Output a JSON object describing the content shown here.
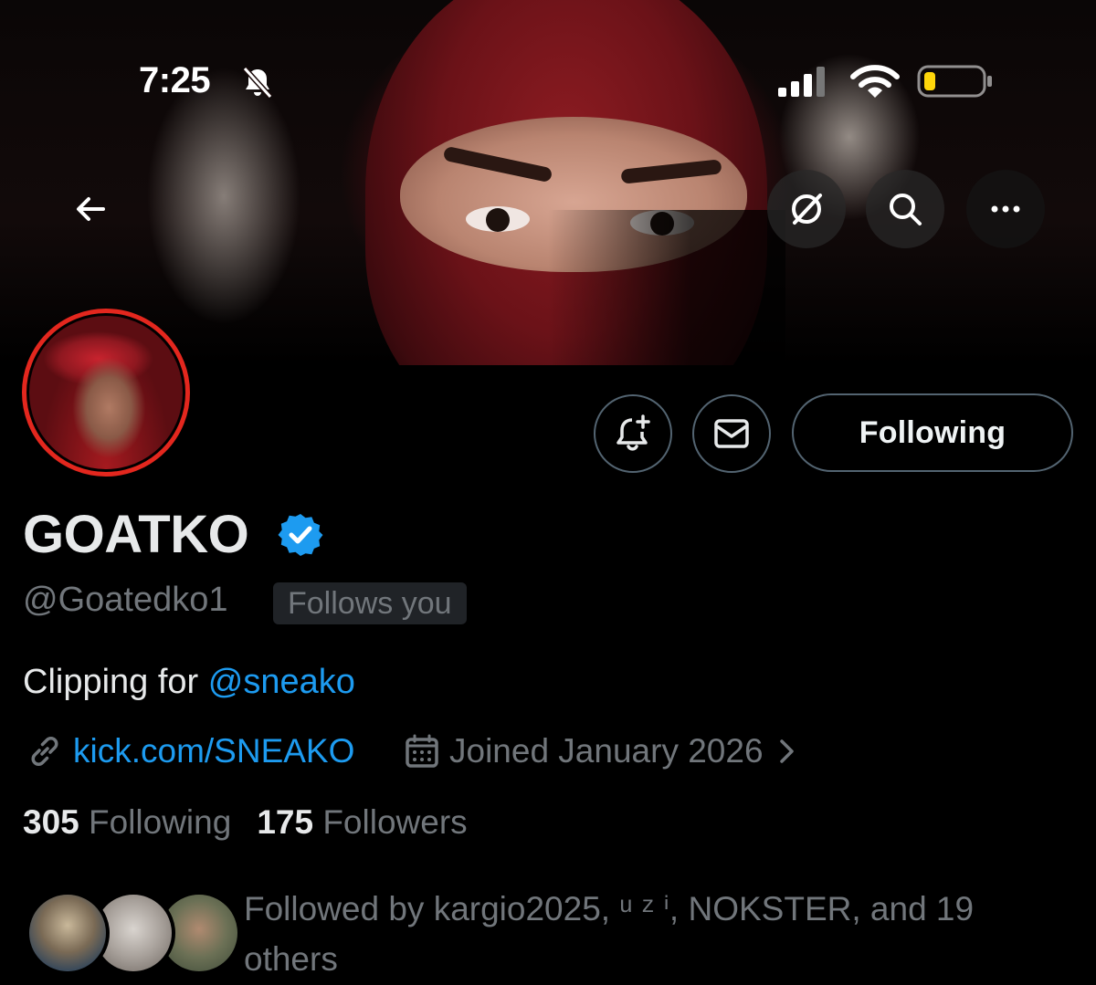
{
  "status_bar": {
    "time": "7:25",
    "icons": [
      "bell-slash-icon",
      "cellular-signal-icon",
      "wifi-icon",
      "battery-low-icon"
    ]
  },
  "banner_buttons": {
    "back": "arrow-left-icon",
    "grok": "grok-icon",
    "search": "search-icon",
    "more": "more-horizontal-icon"
  },
  "actions": {
    "notify_icon": "bell-plus-icon",
    "message_icon": "mail-icon",
    "following_label": "Following"
  },
  "profile": {
    "display_name": "GOATKO",
    "verified": true,
    "handle": "@Goatedko1",
    "follows_you_badge": "Follows you",
    "bio_prefix": "Clipping for ",
    "bio_mention": "@sneako",
    "website": "kick.com/SNEAKO",
    "joined": "Joined January 2026",
    "following_count": "305",
    "following_label": "Following",
    "followers_count": "175",
    "followers_label": "Followers",
    "followed_by": "Followed by kargio2025, ᵘ ᶻ ⁱ, NOKSTER, and 19 others"
  },
  "colors": {
    "accent": "#1d9bf0",
    "muted": "#71767b",
    "avatar_ring": "#e3271e",
    "border": "#536471"
  }
}
